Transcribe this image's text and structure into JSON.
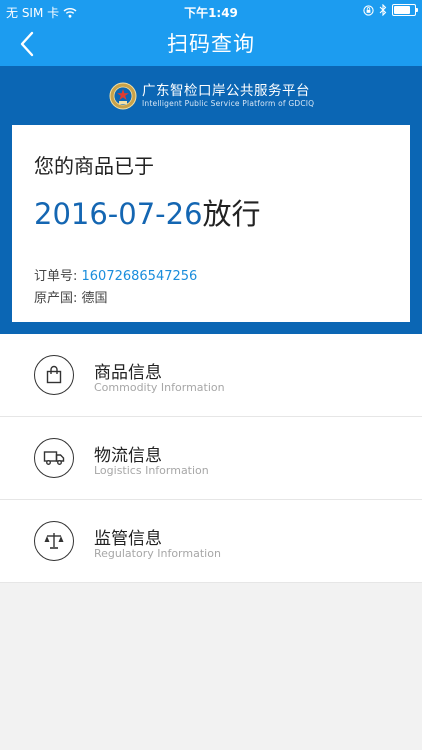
{
  "status_bar": {
    "carrier": "无 SIM 卡",
    "time": "下午1:49"
  },
  "nav": {
    "title": "扫码查询"
  },
  "platform": {
    "name_cn": "广东智检口岸公共服务平台",
    "name_en": "Intelligent Public Service Platform of GDCIQ"
  },
  "result_card": {
    "lead": "您的商品已于",
    "release_date": "2016-07-26",
    "release_suffix": "放行",
    "order_label": "订单号: ",
    "order_number": "16072686547256",
    "origin_label": "原产国: ",
    "origin_value": "德国"
  },
  "menu": {
    "items": [
      {
        "title": "商品信息",
        "subtitle": "Commodity Information",
        "icon": "shopping-bag-icon"
      },
      {
        "title": "物流信息",
        "subtitle": "Logistics Information",
        "icon": "truck-icon"
      },
      {
        "title": "监管信息",
        "subtitle": "Regulatory Information",
        "icon": "scale-icon"
      }
    ]
  },
  "colors": {
    "nav_blue": "#1c9cf0",
    "band_blue": "#0b66b4",
    "date_blue": "#1466b2",
    "order_blue": "#1a8ddc"
  }
}
